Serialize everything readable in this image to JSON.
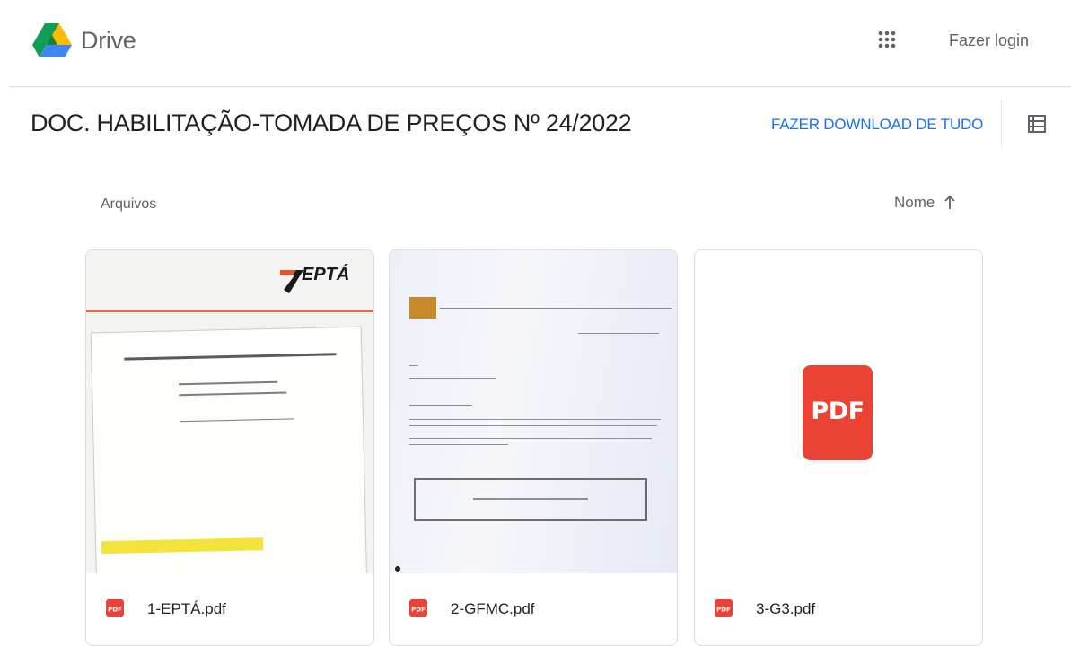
{
  "header": {
    "app_name": "Drive",
    "apps_icon": "apps-grid-icon",
    "login_label": "Fazer login"
  },
  "folder": {
    "title": "DOC. HABILITAÇÃO-TOMADA DE PREÇOS Nº 24/2022",
    "download_all_label": "FAZER DOWNLOAD DE TUDO",
    "view_toggle_icon": "list-view-icon"
  },
  "files_section": {
    "label": "Arquivos",
    "sort_label": "Nome",
    "sort_direction_icon": "arrow-up-icon"
  },
  "files": [
    {
      "name": "1-EPTÁ.pdf",
      "type_icon": "pdf-icon",
      "thumbnail_brand": "EPTÁ"
    },
    {
      "name": "2-GFMC.pdf",
      "type_icon": "pdf-icon"
    },
    {
      "name": "3-G3.pdf",
      "type_icon": "pdf-icon",
      "thumbnail_label": "PDF"
    }
  ],
  "colors": {
    "accent": "#1a73e8",
    "pdf_red": "#ea4335",
    "text": "#202124",
    "muted": "#5f6368"
  }
}
